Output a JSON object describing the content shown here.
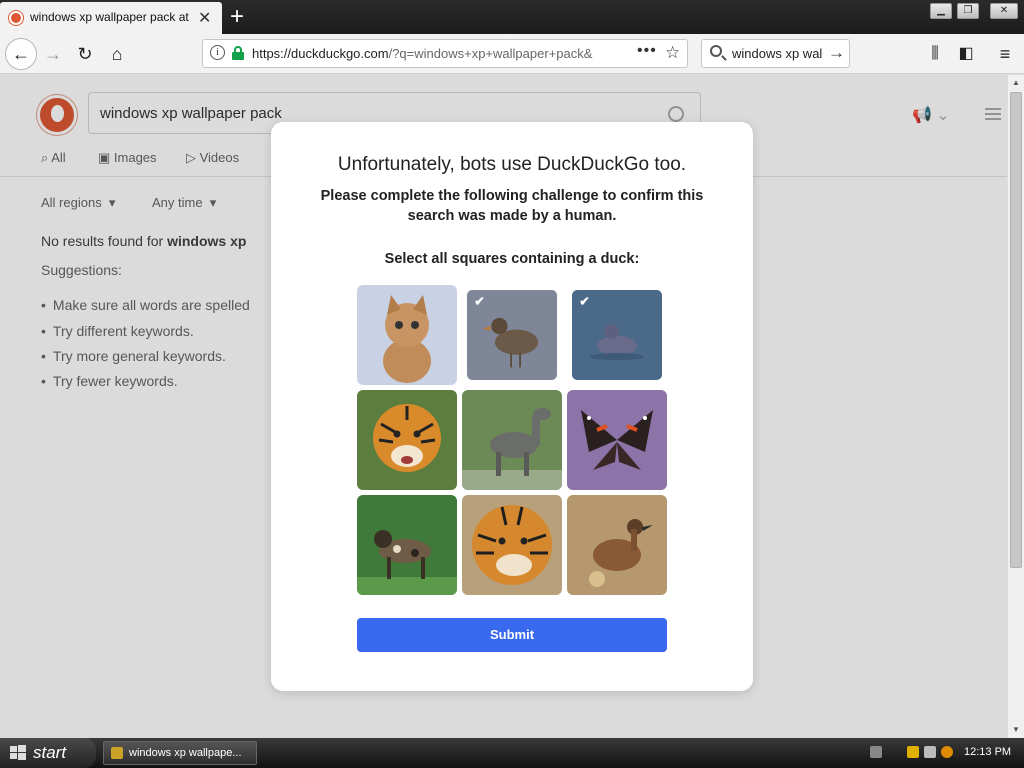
{
  "browser": {
    "tab_title": "windows xp wallpaper pack at D",
    "url_host": "https://duckduckgo.com",
    "url_rest": "/?q=windows+xp+wallpaper+pack&",
    "search_box": "windows xp wal"
  },
  "page": {
    "search_query": "windows xp wallpaper pack",
    "tabs": [
      "All",
      "Images",
      "Videos"
    ],
    "filters": [
      "All regions",
      "Any time"
    ],
    "no_results_prefix": "No results found for ",
    "no_results_query": "windows xp",
    "suggestions_label": "Suggestions:",
    "suggestions": [
      "Make sure all words are spelled",
      "Try different keywords.",
      "Try more general keywords.",
      "Try fewer keywords."
    ]
  },
  "modal": {
    "title": "Unfortunately, bots use DuckDuckGo too.",
    "description": "Please complete the following challenge to confirm this search was made by a human.",
    "instruction": "Select all squares containing a duck:",
    "submit_label": "Submit",
    "tiles": [
      {
        "subject": "kitten",
        "selected": false
      },
      {
        "subject": "duck",
        "selected": true
      },
      {
        "subject": "duck",
        "selected": true
      },
      {
        "subject": "tiger",
        "selected": false
      },
      {
        "subject": "okapi",
        "selected": false
      },
      {
        "subject": "butterfly",
        "selected": false
      },
      {
        "subject": "wild dog",
        "selected": false
      },
      {
        "subject": "tiger",
        "selected": false
      },
      {
        "subject": "duck",
        "selected": false
      }
    ],
    "accent_color": "#3969ef"
  },
  "taskbar": {
    "start_label": "start",
    "task_label": "windows xp wallpape...",
    "clock": "12:13 PM"
  }
}
